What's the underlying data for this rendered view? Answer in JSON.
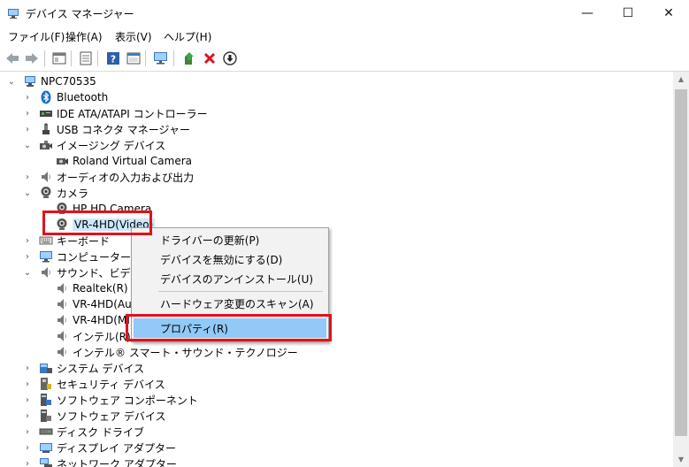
{
  "window": {
    "title": "デバイス マネージャー",
    "minimize": "—",
    "maximize": "☐",
    "close": "✕"
  },
  "menu": [
    {
      "label": "ファイル(F)"
    },
    {
      "label": "操作(A)"
    },
    {
      "label": "表示(V)"
    },
    {
      "label": "ヘルプ(H)"
    }
  ],
  "tree": {
    "root": "NPC70535",
    "items": [
      {
        "label": "Bluetooth",
        "icon": "bluetooth-icon",
        "expanded": false
      },
      {
        "label": "IDE ATA/ATAPI コントローラー",
        "icon": "ide-controller-icon",
        "expanded": false
      },
      {
        "label": "USB コネクタ マネージャー",
        "icon": "usb-icon",
        "expanded": false
      },
      {
        "label": "イメージング デバイス",
        "icon": "imaging-device-icon",
        "expanded": true
      },
      {
        "label": "Roland Virtual Camera",
        "icon": "camera-device-icon",
        "child": true
      },
      {
        "label": "オーディオの入力および出力",
        "icon": "speaker-icon",
        "expanded": false
      },
      {
        "label": "カメラ",
        "icon": "camera-icon",
        "expanded": true
      },
      {
        "label": "HP HD Camera",
        "icon": "camera-icon",
        "child": true
      },
      {
        "label": "VR-4HD(Video)",
        "icon": "camera-icon",
        "child": true,
        "selected": true
      },
      {
        "label": "キーボード",
        "icon": "keyboard-icon",
        "expanded": false
      },
      {
        "label": "コンピューター",
        "icon": "computer-icon",
        "expanded": false
      },
      {
        "label": "サウンド、ビデオ、お",
        "icon": "speaker-icon",
        "expanded": true
      },
      {
        "label": "Realtek(R) A",
        "icon": "speaker-icon",
        "child": true
      },
      {
        "label": "VR-4HD(Aud",
        "icon": "speaker-icon",
        "child": true
      },
      {
        "label": "VR-4HD(MI",
        "icon": "speaker-icon",
        "child": true
      },
      {
        "label": "インテル(R) ス",
        "icon": "speaker-icon",
        "child": true
      },
      {
        "label": "インテル® スマート・サウンド・テクノロジー",
        "icon": "speaker-icon",
        "child": true
      },
      {
        "label": "システム デバイス",
        "icon": "system-device-icon",
        "expanded": false
      },
      {
        "label": "セキュリティ デバイス",
        "icon": "security-device-icon",
        "expanded": false
      },
      {
        "label": "ソフトウェア コンポーネント",
        "icon": "software-component-icon",
        "expanded": false
      },
      {
        "label": "ソフトウェア デバイス",
        "icon": "software-device-icon",
        "expanded": false
      },
      {
        "label": "ディスク ドライブ",
        "icon": "disk-drive-icon",
        "expanded": false
      },
      {
        "label": "ディスプレイ アダプター",
        "icon": "display-adapter-icon",
        "expanded": false
      },
      {
        "label": "ネットワーク アダプター",
        "icon": "network-adapter-icon",
        "expanded": false
      }
    ]
  },
  "context_menu": {
    "items": [
      {
        "label": "ドライバーの更新(P)"
      },
      {
        "label": "デバイスを無効にする(D)"
      },
      {
        "label": "デバイスのアンインストール(U)"
      },
      {
        "label": "ハードウェア変更のスキャン(A)"
      },
      {
        "label": "プロパティ(R)",
        "highlighted": true
      }
    ]
  },
  "colors": {
    "highlight": "#91c9f7",
    "annotation_red": "#e0121c",
    "selection": "#cce8ff"
  }
}
